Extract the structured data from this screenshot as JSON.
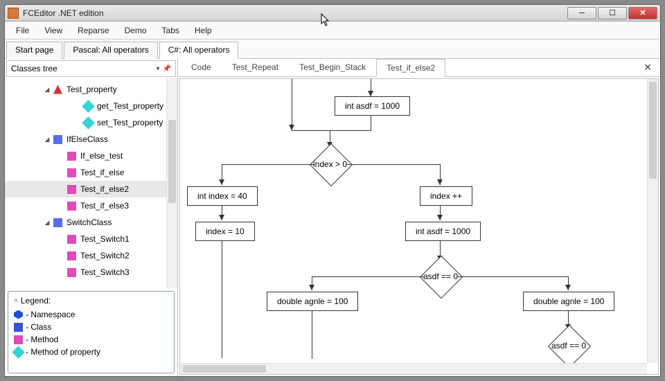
{
  "window": {
    "title": "FCEditor .NET edition"
  },
  "menu": {
    "items": [
      "File",
      "View",
      "Reparse",
      "Demo",
      "Tabs",
      "Help"
    ]
  },
  "file_tabs": {
    "tabs": [
      {
        "label": "Start page",
        "active": false
      },
      {
        "label": "Pascal: All operators",
        "active": false
      },
      {
        "label": "C#: All operators",
        "active": true
      }
    ]
  },
  "sidebar": {
    "panel_title": "Classes tree",
    "tree": [
      {
        "label": "Test_property",
        "icon": "tri",
        "indent": "indent1",
        "expander": "▼"
      },
      {
        "label": "get_Test_property",
        "icon": "prop",
        "indent": "indent2b",
        "expander": ""
      },
      {
        "label": "set_Test_property",
        "icon": "prop",
        "indent": "indent2b",
        "expander": ""
      },
      {
        "label": "IfElseClass",
        "icon": "class2",
        "indent": "indent1",
        "expander": "◀",
        "exp_real": "◢"
      },
      {
        "label": "If_else_test",
        "icon": "method",
        "indent": "indent2",
        "expander": ""
      },
      {
        "label": "Test_if_else",
        "icon": "method",
        "indent": "indent2",
        "expander": ""
      },
      {
        "label": "Test_if_else2",
        "icon": "method",
        "indent": "indent2",
        "expander": "",
        "selected": true
      },
      {
        "label": "Test_if_else3",
        "icon": "method",
        "indent": "indent2",
        "expander": ""
      },
      {
        "label": "SwitchClass",
        "icon": "class2",
        "indent": "indent1",
        "expander": "◢"
      },
      {
        "label": "Test_Switch1",
        "icon": "method",
        "indent": "indent2",
        "expander": ""
      },
      {
        "label": "Test_Switch2",
        "icon": "method",
        "indent": "indent2",
        "expander": ""
      },
      {
        "label": "Test_Switch3",
        "icon": "method",
        "indent": "indent2",
        "expander": ""
      }
    ],
    "legend": {
      "title": "Legend:",
      "rows": [
        {
          "icon": "ns",
          "label": " - Namespace"
        },
        {
          "icon": "class",
          "label": " - Class"
        },
        {
          "icon": "method",
          "label": " - Method"
        },
        {
          "icon": "prop",
          "label": " - Method of property"
        }
      ]
    }
  },
  "code_tabs": {
    "tabs": [
      {
        "label": "Code",
        "active": false
      },
      {
        "label": "Test_Repeat",
        "active": false
      },
      {
        "label": "Test_Begin_Stack",
        "active": false
      },
      {
        "label": "Test_if_else2",
        "active": true
      }
    ]
  },
  "flowchart": {
    "nodes": {
      "n1": "int  asdf = 1000",
      "n2": "index > 0",
      "n3": "int  index = 40",
      "n4": "index ++",
      "n5": "index  = 10",
      "n6": "int  asdf =  1000",
      "n7": "asdf ==  0",
      "n8": "double  agnle = 100",
      "n9": "double  agnle = 100",
      "n10": "asdf ==  0"
    }
  }
}
